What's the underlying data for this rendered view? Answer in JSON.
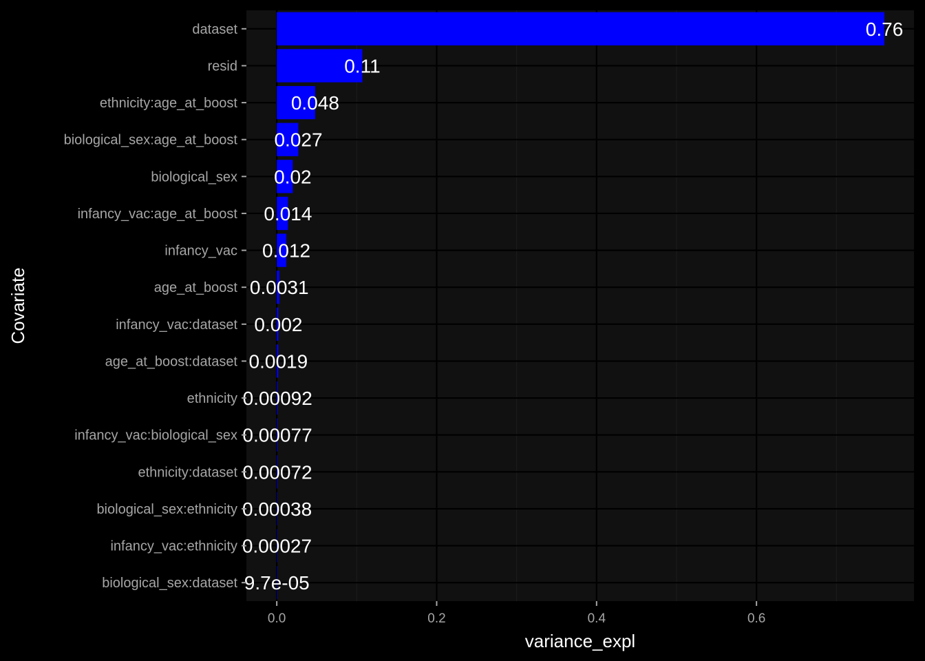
{
  "chart_data": {
    "type": "bar",
    "orientation": "horizontal",
    "categories": [
      "dataset",
      "resid",
      "ethnicity:age_at_boost",
      "biological_sex:age_at_boost",
      "biological_sex",
      "infancy_vac:age_at_boost",
      "infancy_vac",
      "age_at_boost",
      "infancy_vac:dataset",
      "age_at_boost:dataset",
      "ethnicity",
      "infancy_vac:biological_sex",
      "ethnicity:dataset",
      "biological_sex:ethnicity",
      "infancy_vac:ethnicity",
      "biological_sex:dataset"
    ],
    "values": [
      0.76,
      0.107,
      0.048,
      0.027,
      0.02,
      0.014,
      0.012,
      0.0031,
      0.002,
      0.0019,
      0.00092,
      0.00077,
      0.00072,
      0.00038,
      0.00027,
      9.7e-05
    ],
    "labels": [
      "0.76",
      "0.11",
      "0.048",
      "0.027",
      "0.02",
      "0.014",
      "0.012",
      "0.0031",
      "0.002",
      "0.0019",
      "0.00092",
      "0.00077",
      "0.00072",
      "0.00038",
      "0.00027",
      "9.7e-05"
    ],
    "xlabel": "variance_expl",
    "ylabel": "Covariate",
    "xlim": [
      -0.038,
      0.797
    ],
    "xticks": [
      0.0,
      0.2,
      0.4,
      0.6
    ],
    "xtick_labels": [
      "0.0",
      "0.2",
      "0.4",
      "0.6"
    ],
    "grid": true,
    "colors": {
      "bar": "#0000ff",
      "panel": "#111111",
      "background": "#000000",
      "grid_major": "#000000",
      "grid_minor": "#1c1c1c"
    }
  }
}
